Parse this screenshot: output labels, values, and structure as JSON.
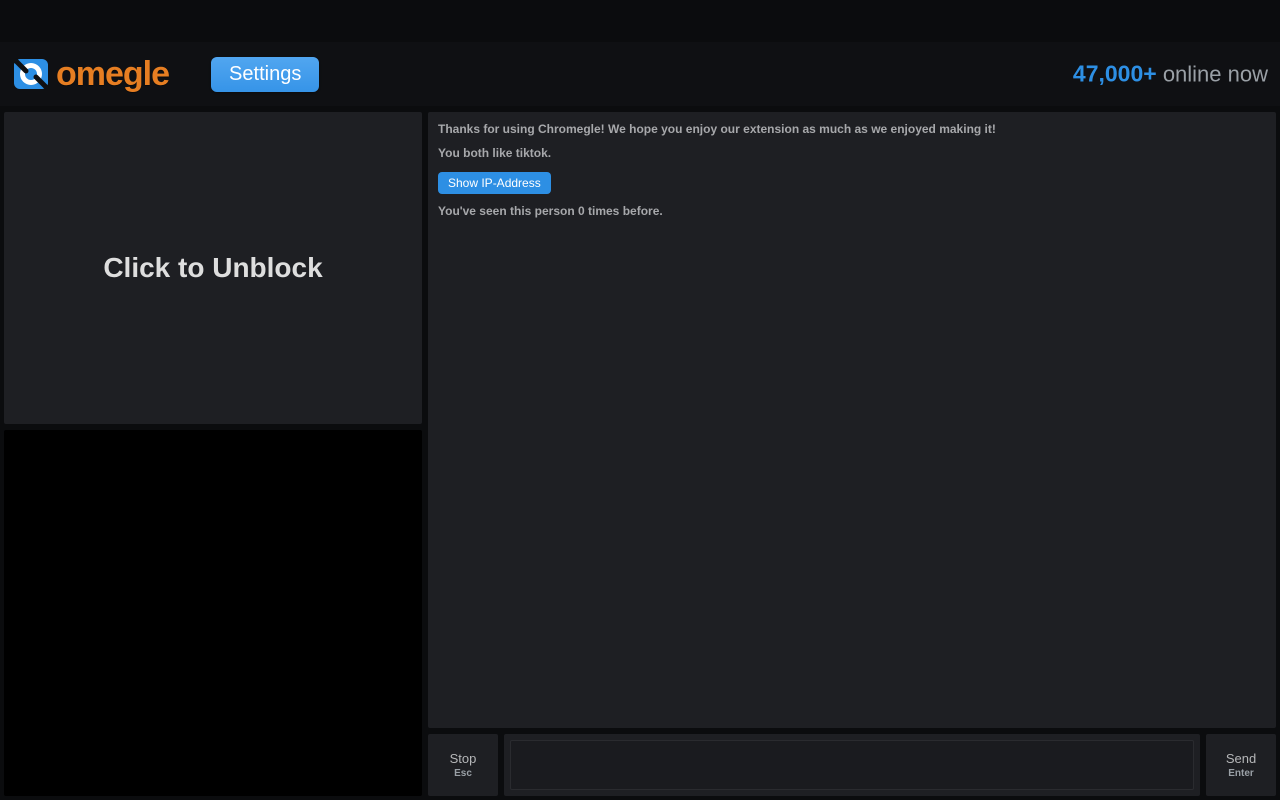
{
  "header": {
    "logo_text": "omegle",
    "settings_label": "Settings",
    "online_count": "47,000+",
    "online_suffix": "online now"
  },
  "video": {
    "unblock_label": "Click to Unblock"
  },
  "chat": {
    "welcome": "Thanks for using Chromegle! We hope you enjoy our extension as much as we enjoyed making it!",
    "common_interests": "You both like tiktok.",
    "show_ip_label": "Show IP-Address",
    "seen_before": "You've seen this person 0 times before."
  },
  "controls": {
    "stop_label": "Stop",
    "stop_key": "Esc",
    "send_label": "Send",
    "send_key": "Enter",
    "msg_placeholder": ""
  }
}
